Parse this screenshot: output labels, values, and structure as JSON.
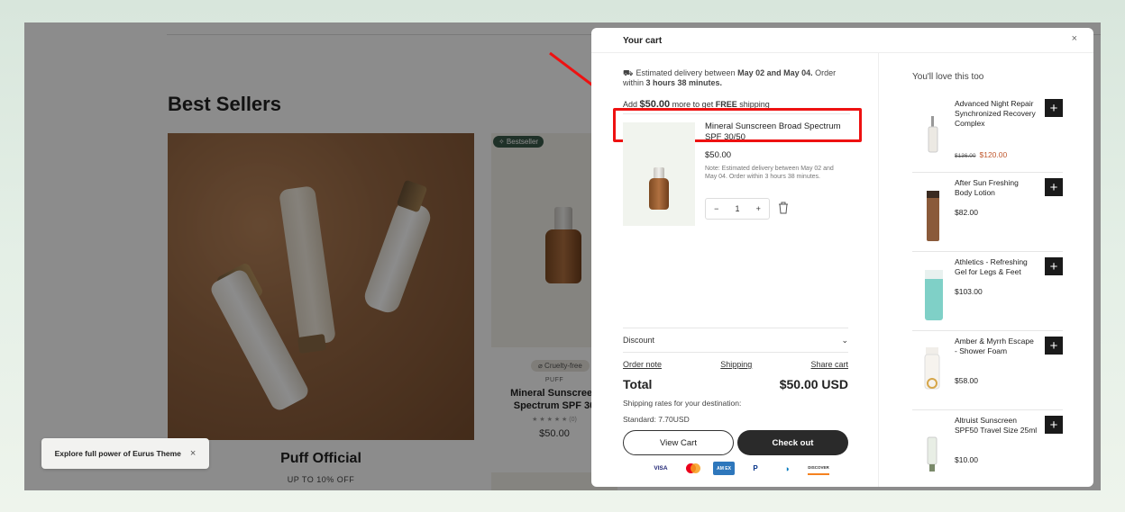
{
  "store": {
    "section_title": "Best Sellers",
    "collection_title": "Puff Official",
    "collection_subtitle": "UP TO 10% OFF",
    "badge_bestseller": "✧ Bestseller",
    "badge_cruelty": "⌀ Cruelty-free",
    "product_brand": "PUFF",
    "product_name": "Mineral Sunscreen Spectrum SPF 30",
    "product_stars": "★ ★ ★ ★ ★ (0)",
    "product_price": "$50.00"
  },
  "toast": {
    "text": "Explore full power of Eurus Theme",
    "close": "×"
  },
  "cart": {
    "title": "Your cart",
    "close": "×",
    "delivery_prefix": "Estimated delivery between ",
    "delivery_dates": "May 02 and May 04.",
    "delivery_mid": " Order within ",
    "delivery_time": "3 hours 38 minutes.",
    "shipping_prefix": "Add ",
    "shipping_amount": "$50.00",
    "shipping_mid": " more to get ",
    "shipping_free": "FREE",
    "shipping_suffix": " shipping",
    "item": {
      "name": "Mineral Sunscreen Broad Spectrum SPF 30/50",
      "price": "$50.00",
      "note": "Note: Estimated delivery between May 02 and May 04. Order within 3 hours 38 minutes.",
      "qty_minus": "−",
      "qty": "1",
      "qty_plus": "+"
    },
    "discount_label": "Discount",
    "discount_chevron": "⌄",
    "links": {
      "order_note": "Order note",
      "shipping": "Shipping",
      "share_cart": "Share cart"
    },
    "total_label": "Total",
    "total_value": "$50.00 USD",
    "rates_text": "Shipping rates for your destination:",
    "standard_text": "Standard: 7.70USD",
    "view_cart": "View Cart",
    "check_out": "Check out",
    "payments": {
      "visa": "VISA",
      "amex": "AM EX",
      "paypal": "P",
      "diners": "◑",
      "discover": "DISCOVER"
    }
  },
  "recommend": {
    "title": "You'll love this too",
    "items": [
      {
        "name": "Advanced Night Repair Synchronized Recovery Complex",
        "old_price": "$136.00",
        "price": "$120.00",
        "add": "+"
      },
      {
        "name": "After Sun Freshing Body Lotion",
        "price": "$82.00",
        "add": "+"
      },
      {
        "name": "Athletics - Refreshing Gel for Legs & Feet",
        "price": "$103.00",
        "add": "+"
      },
      {
        "name": "Amber & Myrrh Escape - Shower Foam",
        "price": "$58.00",
        "add": "+"
      },
      {
        "name": "Altruist Sunscreen SPF50 Travel Size 25ml",
        "price": "$10.00",
        "add": "+"
      }
    ]
  },
  "colors": {
    "highlight": "#e11111",
    "accent": "#c0582e",
    "dark_button": "#2a2a2a"
  }
}
